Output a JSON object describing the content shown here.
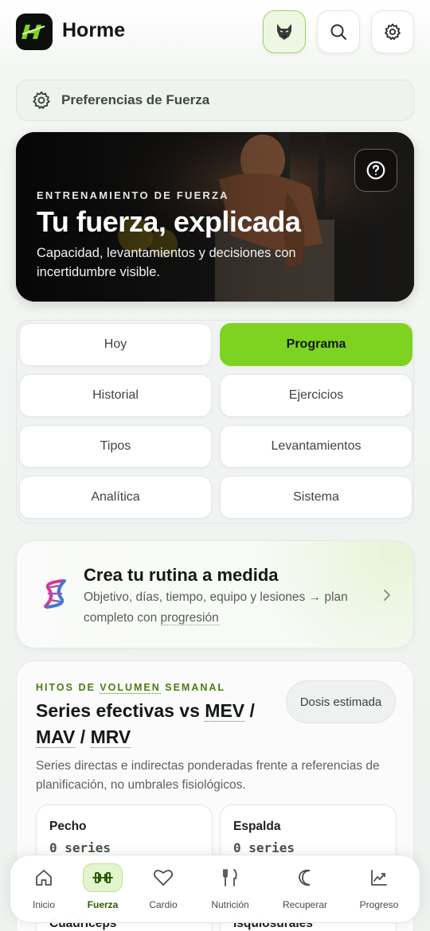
{
  "header": {
    "app_name": "Horme",
    "logo_icon": "horme-logo-icon",
    "buttons": [
      "wolf-icon",
      "search-icon",
      "gear-icon"
    ]
  },
  "preferences": {
    "label": "Preferencias de Fuerza"
  },
  "hero": {
    "eyebrow": "ENTRENAMIENTO DE FUERZA",
    "title": "Tu fuerza, explicada",
    "subtitle": "Capacidad, levantamientos y decisiones con incertidumbre visible."
  },
  "tabs": [
    {
      "label": "Hoy",
      "active": false
    },
    {
      "label": "Programa",
      "active": true
    },
    {
      "label": "Historial",
      "active": false
    },
    {
      "label": "Ejercicios",
      "active": false
    },
    {
      "label": "Tipos",
      "active": false
    },
    {
      "label": "Levantamientos",
      "active": false
    },
    {
      "label": "Analítica",
      "active": false
    },
    {
      "label": "Sistema",
      "active": false
    }
  ],
  "routine": {
    "title": "Crea tu rutina a medida",
    "desc_part1": "Objetivo, días, tiempo, equipo y lesiones → plan completo con ",
    "desc_link": "progresión"
  },
  "volume": {
    "eyebrow_pre": "HITOS DE ",
    "eyebrow_u": "VOLUMEN",
    "eyebrow_post": " SEMANAL",
    "title_pre": "Series efectivas vs ",
    "mev": "MEV",
    "sep1": " / ",
    "mav": "MAV",
    "sep2": " / ",
    "mrv": "MRV",
    "dose_button": "Dosis estimada",
    "desc": "Series directas e indirectas ponderadas frente a referencias de planificación, no umbrales fisiológicos.",
    "muscles": [
      {
        "name": "Pecho",
        "value": "0 series"
      },
      {
        "name": "Espalda",
        "value": "0 series"
      },
      {
        "name": "Cuádriceps",
        "value": ""
      },
      {
        "name": "Isquiosurales",
        "value": ""
      }
    ]
  },
  "nav": [
    {
      "label": "Inicio",
      "icon": "home-icon",
      "active": false
    },
    {
      "label": "Fuerza",
      "icon": "dumbbell-icon",
      "active": true
    },
    {
      "label": "Cardio",
      "icon": "heart-icon",
      "active": false
    },
    {
      "label": "Nutrición",
      "icon": "fork-knife-icon",
      "active": false
    },
    {
      "label": "Recuperar",
      "icon": "moon-icon",
      "active": false
    },
    {
      "label": "Progreso",
      "icon": "chart-line-icon",
      "active": false
    }
  ],
  "colors": {
    "accent": "#7ed321",
    "accent_dark": "#4c7d10"
  }
}
